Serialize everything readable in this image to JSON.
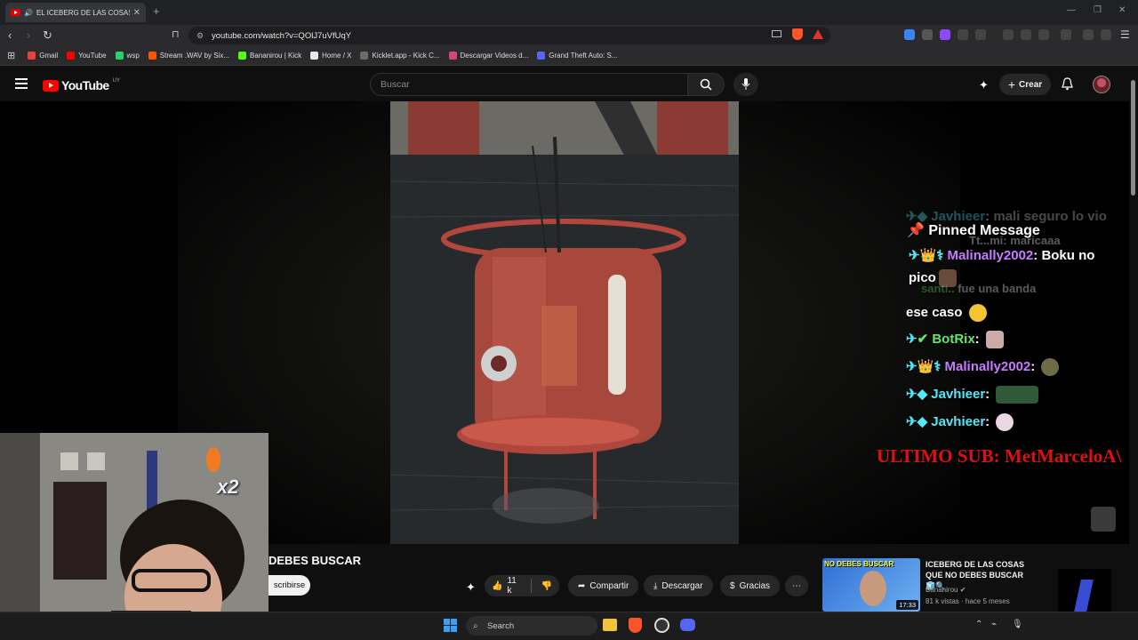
{
  "browser": {
    "tab_title": "EL ICEBERG DE LAS COSAS Q",
    "url": "youtube.com/watch?v=QOlJ7uVfUqY",
    "bookmarks": [
      {
        "label": "Gmail",
        "color": "#ea4335"
      },
      {
        "label": "YouTube",
        "color": "#ff0000"
      },
      {
        "label": "wsp",
        "color": "#25d366"
      },
      {
        "label": "Stream .WAV by Six...",
        "color": "#ff5500"
      },
      {
        "label": "Bananirou | Kick",
        "color": "#53fc18"
      },
      {
        "label": "Home / X",
        "color": "#e7e7e7"
      },
      {
        "label": "Kicklet.app - Kick C...",
        "color": "#6b6b6b"
      },
      {
        "label": "Descargar Videos d...",
        "color": "#d6457a"
      },
      {
        "label": "Grand Theft Auto: S...",
        "color": "#5865f2"
      }
    ]
  },
  "youtube": {
    "logo_text": "YouTube",
    "country": "UY",
    "search_placeholder": "Buscar",
    "create_label": "Crear"
  },
  "chat": {
    "lines": [
      {
        "user": "Javhieer",
        "msg": "mali seguro lo vio"
      },
      {
        "pinned": "Pinned Message"
      },
      {
        "user": "Malinally2002",
        "msg": "Boku no"
      },
      {
        "cont": "pico"
      },
      {
        "cont": "ese caso"
      },
      {
        "user": "BotRix",
        "msg": ""
      },
      {
        "user": "Malinally2002",
        "msg": ""
      },
      {
        "user": "Javhieer",
        "msg": ""
      },
      {
        "user": "Javhieer",
        "msg": ""
      }
    ],
    "faded_1": "Tt...mi: maricaaa",
    "faded_2": "fue una banda",
    "ultimo_sub": "ULTIMO SUB: MetMarceloA\\",
    "multiplier": "x2"
  },
  "video": {
    "title_fragment": "DEBES BUSCAR",
    "subscribe_fragment": "scribirse",
    "likes": "11 k",
    "share": "Compartir",
    "download": "Descargar",
    "thanks": "Gracias"
  },
  "recommendation": {
    "title": "ICEBERG DE LAS COSAS QUE NO DEBES BUSCAR🧊🔍",
    "channel": "Bananirou",
    "meta": "81 k vistas · hace 5 meses",
    "duration": "17:33",
    "thumb_text": "NO DEBES BUSCAR"
  },
  "taskbar": {
    "search_label": "Search"
  },
  "colors": {
    "yt_red": "#ff0000",
    "chat_cyan": "#54e7f8",
    "chat_purple": "#c77bff",
    "chat_green": "#63e96a",
    "ultimo_red": "#dd1111"
  }
}
